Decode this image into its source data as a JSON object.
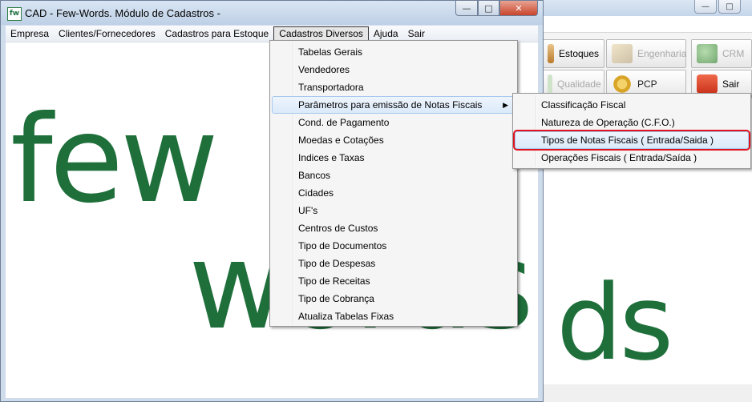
{
  "window": {
    "title": "CAD - Few-Words. Módulo de Cadastros -",
    "app_icon_text": "fw",
    "controls": {
      "minimize": "—",
      "maximize": "□",
      "close": "✕"
    }
  },
  "menubar": {
    "items": [
      {
        "label": "Empresa"
      },
      {
        "label": "Clientes/Fornecedores"
      },
      {
        "label": "Cadastros para Estoque"
      },
      {
        "label": "Cadastros Diversos"
      },
      {
        "label": "Ajuda"
      },
      {
        "label": "Sair"
      }
    ],
    "active": "Cadastros Diversos"
  },
  "cadastros_menu": {
    "items": [
      {
        "label": "Tabelas Gerais"
      },
      {
        "label": "Vendedores"
      },
      {
        "label": "Transportadora"
      },
      {
        "label": "Parâmetros para emissão de Notas Fiscais"
      },
      {
        "label": "Cond. de Pagamento"
      },
      {
        "label": "Moedas e Cotações"
      },
      {
        "label": "Indices e Taxas"
      },
      {
        "label": "Bancos"
      },
      {
        "label": "Cidades"
      },
      {
        "label": "UF's"
      },
      {
        "label": "Centros de Custos"
      },
      {
        "label": "Tipo de Documentos"
      },
      {
        "label": "Tipo de Despesas"
      },
      {
        "label": "Tipo de Receitas"
      },
      {
        "label": "Tipo de Cobrança"
      },
      {
        "label": "Atualiza Tabelas Fixas"
      }
    ],
    "submenu_arrow": "▶"
  },
  "parametros_submenu": {
    "items": [
      {
        "label": "Classificação Fiscal"
      },
      {
        "label": "Natureza de Operação (C.F.O.)"
      },
      {
        "label": "Tipos de Notas Fiscais ( Entrada/Saida )"
      },
      {
        "label": "Operações Fiscais ( Entrada/Saída )"
      }
    ],
    "highlight_color": "#e0141c"
  },
  "logo": {
    "line1": "few",
    "line2": "words"
  },
  "background_app": {
    "controls": {
      "minimize": "—",
      "maximize": "□"
    },
    "toolbar": [
      {
        "label": "Estoques",
        "icon": "stock-icon"
      },
      {
        "label": "Engenharia",
        "icon": "engineering-icon"
      },
      {
        "label": "CRM",
        "icon": "crm-icon"
      },
      {
        "label": "Qualidade",
        "icon": "quality-icon"
      },
      {
        "label": "PCP",
        "icon": "pcp-gear-icon"
      },
      {
        "label": "Sair",
        "icon": "power-icon"
      }
    ]
  }
}
